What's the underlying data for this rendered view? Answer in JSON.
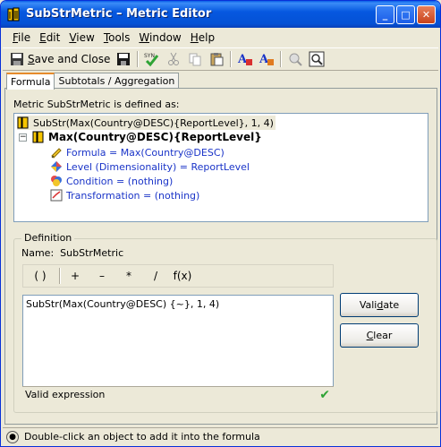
{
  "window": {
    "title": "SubStrMetric – Metric Editor",
    "controls": {
      "minimize": "_",
      "maximize": "□",
      "close": "✕"
    }
  },
  "menu": {
    "file": {
      "key": "F",
      "rest": "ile"
    },
    "edit": {
      "key": "E",
      "rest": "dit"
    },
    "view": {
      "key": "V",
      "rest": "iew"
    },
    "tools": {
      "key": "T",
      "rest": "ools"
    },
    "window": {
      "key": "W",
      "rest": "indow"
    },
    "help": {
      "key": "H",
      "rest": "elp"
    }
  },
  "toolbar": {
    "save_close_pre": "",
    "save_close_key": "S",
    "save_close_rest": "ave and Close",
    "icons": [
      "save-close-icon",
      "save-icon",
      "check-syntax-icon",
      "cut-icon",
      "copy-icon",
      "paste-icon",
      "bold-a-icon",
      "format-a-icon",
      "search-icon",
      "properties-icon"
    ]
  },
  "tabs": [
    {
      "label": "Formula",
      "active": true
    },
    {
      "label": "Subtotals / Aggregation",
      "active": false
    }
  ],
  "caption": "Metric  SubStrMetric  is defined as:",
  "tree": {
    "root": "SubStr(Max(Country@DESC){ReportLevel}, 1, 4)",
    "child": "Max(Country@DESC){ReportLevel}",
    "items": [
      {
        "text": "Formula = Max(Country@DESC)",
        "color": "#1a34c8",
        "icon": "formula-icon"
      },
      {
        "text": "Level (Dimensionality) = ReportLevel",
        "color": "#1a34c8",
        "icon": "level-icon"
      },
      {
        "text": "Condition = (nothing)",
        "color": "#1a34c8",
        "icon": "condition-icon"
      },
      {
        "text": "Transformation = (nothing)",
        "color": "#1a34c8",
        "icon": "transformation-icon"
      }
    ]
  },
  "definition": {
    "group_title": "Definition",
    "name_label": "Name:",
    "name_value": "SubStrMetric",
    "operators": {
      "paren": "( )",
      "plus": "+",
      "minus": "–",
      "multiply": "*",
      "divide": "/",
      "fx": "f(x)"
    },
    "expression": "SubStr(Max(Country@DESC) {~}, 1, 4)",
    "validation_message": "Valid expression",
    "validate_button": {
      "pre": "Vali",
      "key": "d",
      "rest": "ate"
    },
    "clear_button": {
      "pre": "",
      "key": "C",
      "rest": "lear"
    }
  },
  "statusbar": {
    "text": "Double-click an object to add it into the formula"
  },
  "colors": {
    "titlebar": "#0658e0",
    "active_tab_accent": "#e68b2c",
    "valid_check": "#2ea335"
  }
}
